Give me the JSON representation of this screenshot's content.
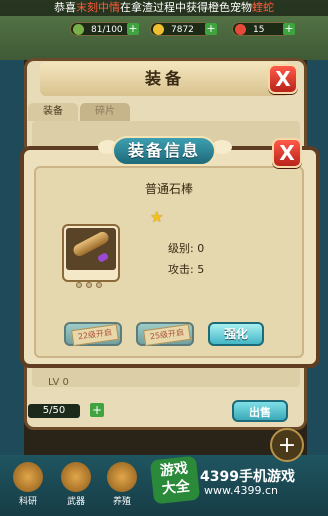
{
  "marquee": {
    "prefix": "恭喜",
    "player": "末刻中情",
    "middle": "在拿渣过程中获得橙色宠物",
    "pet": "蝰蛇"
  },
  "resources": [
    {
      "value": "81/100",
      "color": "#7ab04a"
    },
    {
      "value": "7872",
      "color": "#f0c030"
    },
    {
      "value": "15",
      "color": "#e84a3a"
    }
  ],
  "equip_panel": {
    "title": "装备",
    "tabs": [
      "装备",
      "碎片"
    ],
    "lv_row": "LV 0",
    "count": "5/50",
    "count_plus": "+",
    "sell_label": "出售",
    "close_label": "X"
  },
  "info_dialog": {
    "title": "装备信息",
    "close_label": "X",
    "item_name": "普通石棒",
    "star": "★",
    "level_label": "级别: 0",
    "attack_label": "攻击: 5",
    "buttons": [
      {
        "label": "22级开启",
        "locked": true
      },
      {
        "label": "25级开启",
        "locked": true
      },
      {
        "label": "强化",
        "locked": false
      }
    ]
  },
  "nav": [
    "科研",
    "武器",
    "养殖"
  ],
  "corner_button": "+",
  "watermark": {
    "badge_line1": "游戏",
    "badge_line2": "大全",
    "brand": "4399手机游戏",
    "url": "www.4399.cn"
  }
}
